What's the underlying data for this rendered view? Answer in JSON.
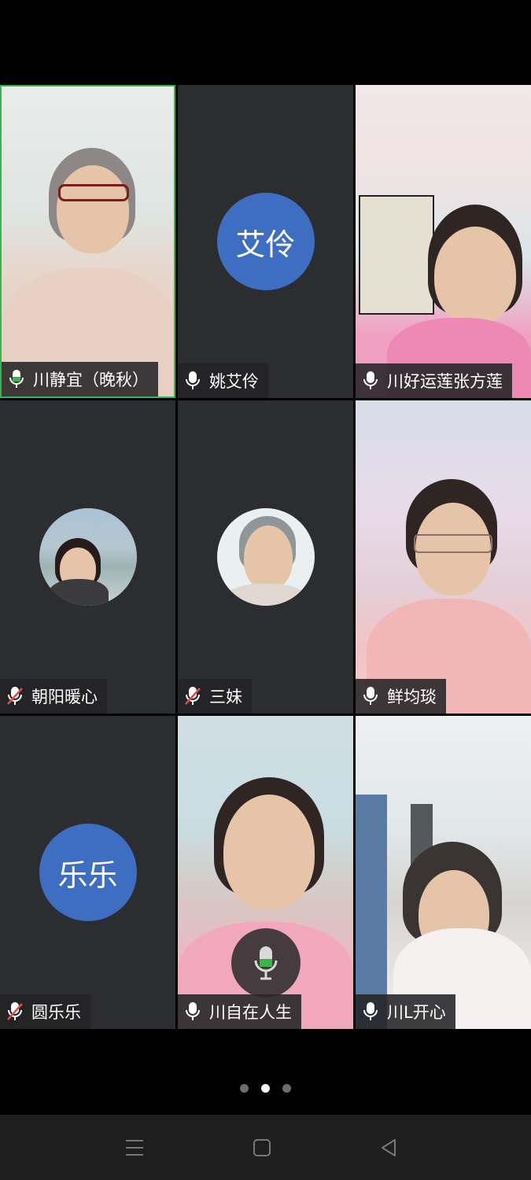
{
  "participants": [
    {
      "name": "川静宜（晚秋）",
      "mic": "on",
      "video": "on"
    },
    {
      "name": "姚艾伶",
      "mic": "on",
      "video": "off",
      "initials": "艾伶"
    },
    {
      "name": "川好运莲张方莲",
      "mic": "on",
      "video": "on"
    },
    {
      "name": "朝阳暖心",
      "mic": "muted",
      "video": "off"
    },
    {
      "name": "三妹",
      "mic": "muted",
      "video": "off"
    },
    {
      "name": "鲜均琰",
      "mic": "on",
      "video": "on"
    },
    {
      "name": "圆乐乐",
      "mic": "muted",
      "video": "off",
      "initials": "乐乐"
    },
    {
      "name": "川自在人生",
      "mic": "on",
      "video": "on"
    },
    {
      "name": "川L开心",
      "mic": "on",
      "video": "on"
    }
  ],
  "page_indicator": {
    "total": 3,
    "current": 2
  },
  "colors": {
    "active_speaker_border": "#3bb54a",
    "avatar_bg": "#3e6ec2",
    "tile_bg": "#2b2d31",
    "muted_icon": "#e24b4b"
  },
  "nav_icons": [
    "menu-icon",
    "home-icon",
    "back-icon"
  ]
}
